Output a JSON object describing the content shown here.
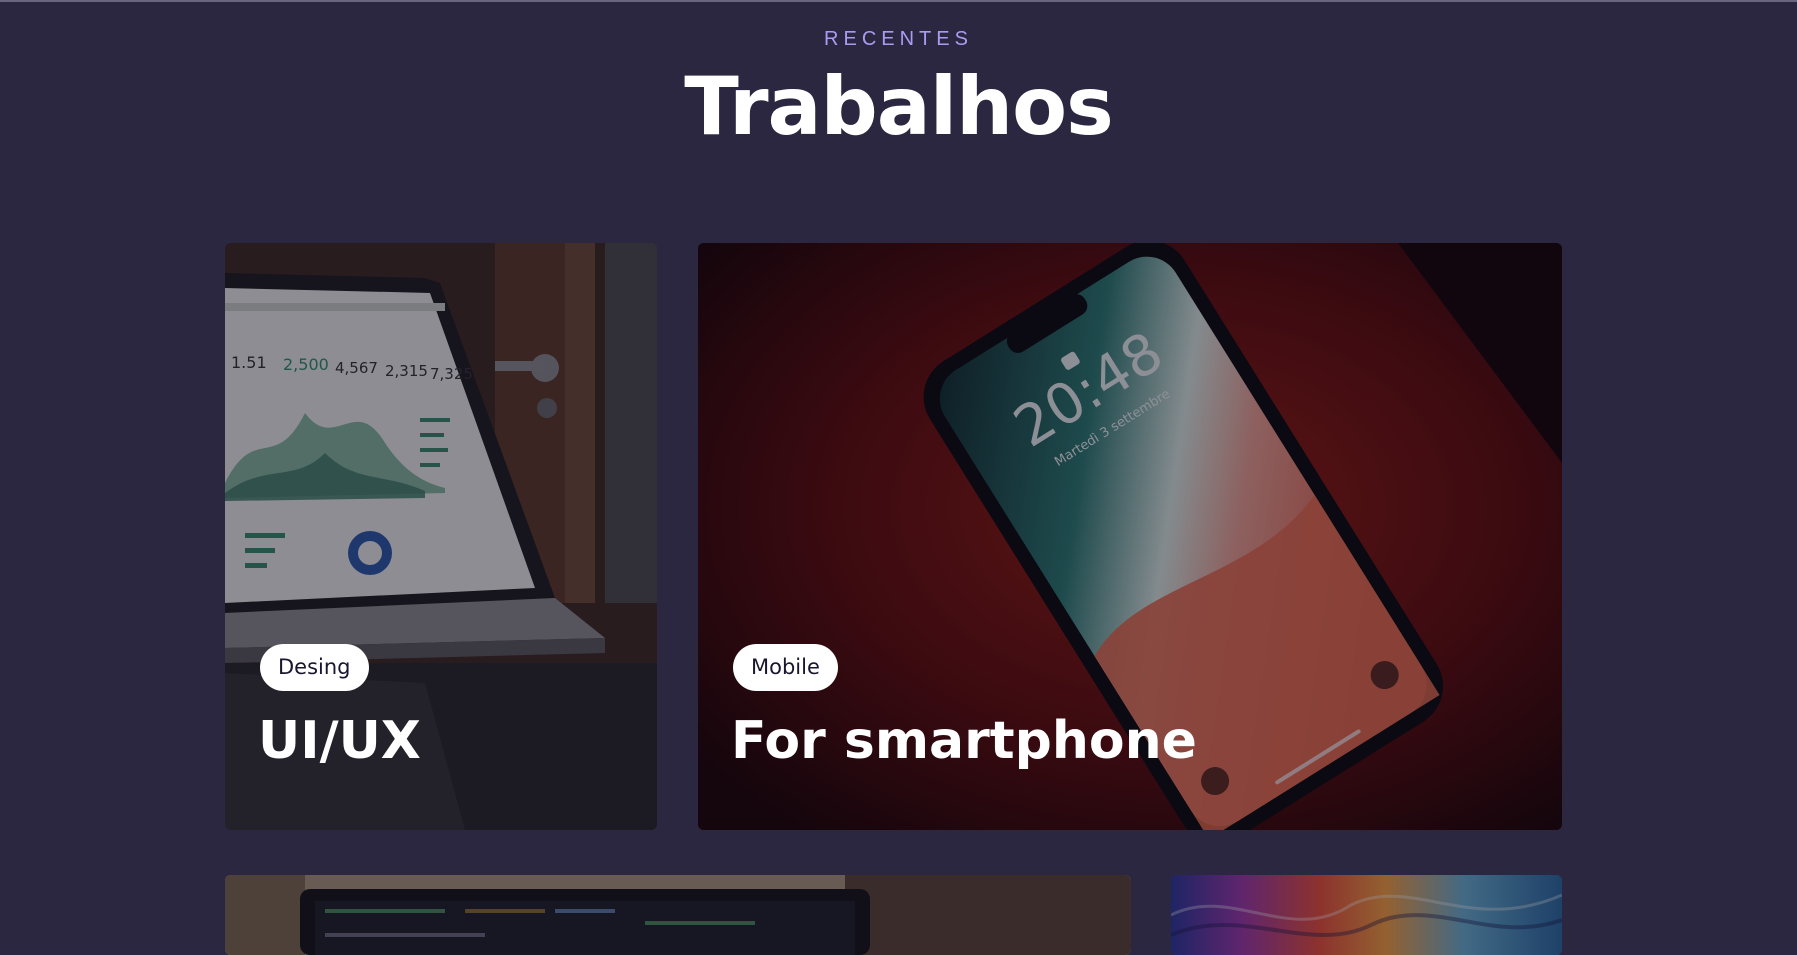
{
  "section": {
    "eyebrow": "RECENTES",
    "title": "Trabalhos"
  },
  "cards": [
    {
      "tag": "Desing",
      "title": "UI/UX"
    },
    {
      "tag": "Mobile",
      "title": "For smartphone"
    }
  ],
  "colors": {
    "background": "#2b2740",
    "eyebrow": "#a99cf0",
    "badge_bg": "#ffffff",
    "badge_text": "#1b1630"
  }
}
